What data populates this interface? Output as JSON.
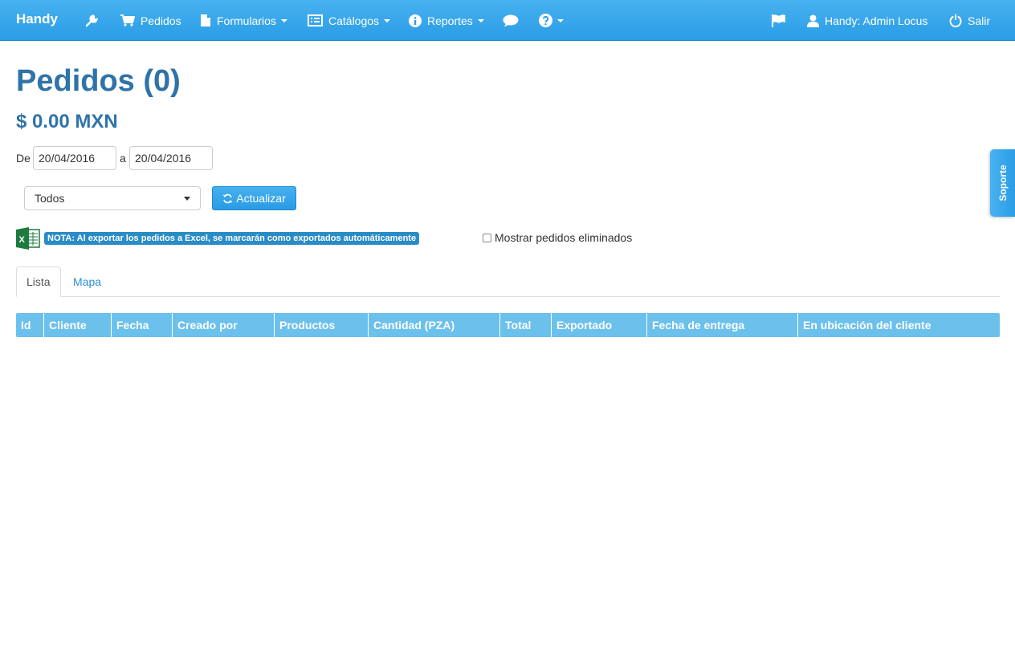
{
  "navbar": {
    "brand": "Handy",
    "items": [
      {
        "label": "Pedidos",
        "icon": "cart-icon"
      },
      {
        "label": "Formularios",
        "icon": "file-icon"
      },
      {
        "label": "Catálogos",
        "icon": "list-icon"
      },
      {
        "label": "Reportes",
        "icon": "info-icon"
      }
    ],
    "user": "Handy: Admin Locus",
    "logout": "Salir"
  },
  "page": {
    "title": "Pedidos (0)",
    "amount": "$ 0.00 MXN"
  },
  "filters": {
    "from_label": "De",
    "from_value": "20/04/2016",
    "to_label": "a",
    "to_value": "20/04/2016",
    "status_selected": "Todos",
    "refresh_label": "Actualizar"
  },
  "note": {
    "text": "NOTA: Al exportar los pedidos a Excel, se marcarán como exportados automáticamente",
    "excel_logo_letter": "X",
    "show_deleted_label": "Mostrar pedidos eliminados",
    "show_deleted_checked": false
  },
  "tabs": [
    {
      "label": "Lista",
      "active": true
    },
    {
      "label": "Mapa",
      "active": false
    }
  ],
  "table": {
    "columns": [
      "Id",
      "Cliente",
      "Fecha",
      "Creado por",
      "Productos",
      "Cantidad (PZA)",
      "Total",
      "Exportado",
      "Fecha de entrega",
      "En ubicación del cliente"
    ],
    "rows": []
  },
  "support": {
    "label": "Soporte"
  },
  "colors": {
    "navbar": "#2a9de6",
    "title": "#2f73a8",
    "table_header": "#6cc0ec",
    "link": "#2a8fd8"
  }
}
